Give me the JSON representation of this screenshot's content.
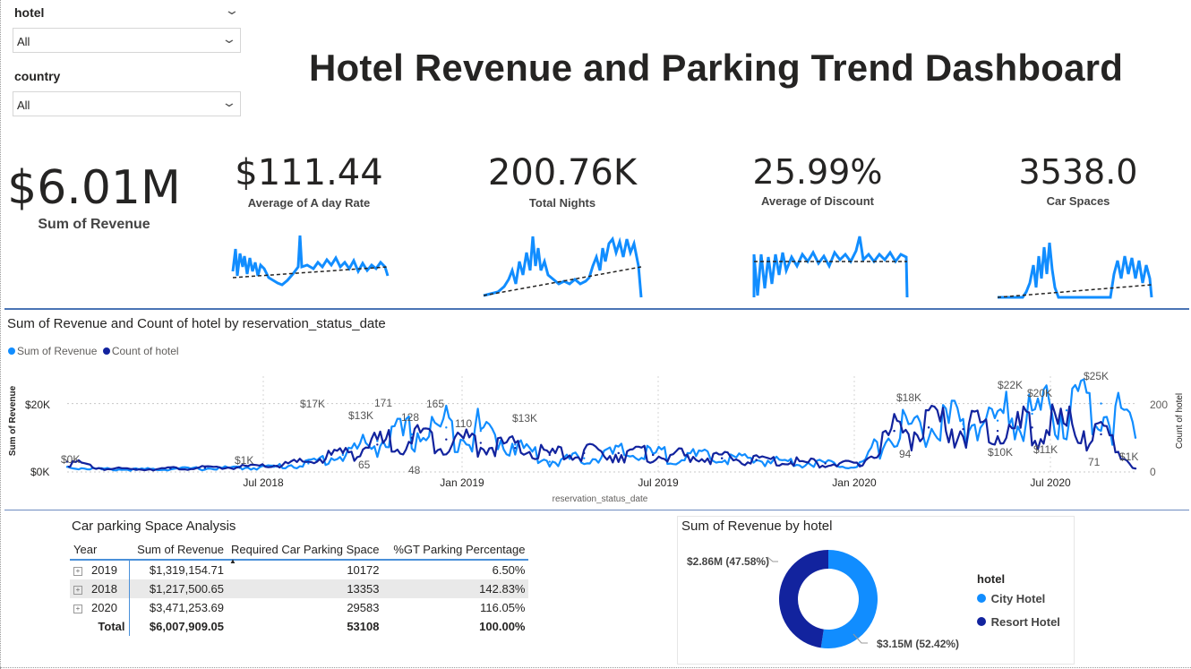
{
  "filters": {
    "hotel": {
      "label": "hotel",
      "value": "All"
    },
    "country": {
      "label": "country",
      "value": "All"
    }
  },
  "dashboard_title": "Hotel Revenue and Parking Trend Dashboard",
  "kpis": {
    "revenue": {
      "value": "$6.01M",
      "label": "Sum of Revenue"
    },
    "adr": {
      "value": "$111.44",
      "label": "Average of A day Rate"
    },
    "nights": {
      "value": "200.76K",
      "label": "Total Nights"
    },
    "discount": {
      "value": "25.99%",
      "label": "Average of Discount"
    },
    "parking": {
      "value": "3538.0",
      "label": "Car Spaces"
    }
  },
  "colors": {
    "revenue": "#118dff",
    "count": "#12239e",
    "city_hotel": "#118dff",
    "resort_hotel": "#12239e",
    "divider": "#4a74b5"
  },
  "chart_data": [
    {
      "type": "line",
      "title": "Sum of Revenue and Count of hotel by reservation_status_date",
      "xlabel": "reservation_status_date",
      "ylabel": "Sum of Revenue",
      "y2label": "Count of hotel",
      "legend_position": "top-left",
      "x_ticks": [
        "Jul 2018",
        "Jan 2019",
        "Jul 2019",
        "Jan 2020",
        "Jul 2020"
      ],
      "y_ticks": [
        "$0K",
        "$20K"
      ],
      "y2_ticks": [
        "0",
        "200"
      ],
      "ylim": [
        0,
        28000
      ],
      "y2lim": [
        0,
        280
      ],
      "grid": true,
      "x_period": [
        "2017-10",
        "2020-09"
      ],
      "series": [
        {
          "name": "Sum of Revenue",
          "axis": "left",
          "values": [
            1500,
            800,
            700,
            900,
            1000,
            1200,
            1500,
            2500,
            5000,
            9000,
            11000,
            13000,
            12000,
            8000,
            3000,
            4000,
            5500,
            5000,
            4500,
            4000,
            3500,
            3000,
            2500,
            2000,
            12000,
            13000,
            14000,
            15000,
            17000,
            18000,
            20000,
            10000
          ]
        },
        {
          "name": "Count of hotel",
          "axis": "right",
          "values": [
            30,
            10,
            8,
            10,
            12,
            14,
            18,
            30,
            55,
            80,
            100,
            95,
            85,
            70,
            50,
            55,
            55,
            50,
            45,
            40,
            35,
            30,
            25,
            20,
            120,
            130,
            125,
            120,
            130,
            135,
            110,
            10
          ]
        }
      ],
      "annotations": [
        "$0K",
        "$1K",
        "$17K",
        "$13K",
        "171",
        "128",
        "165",
        "110",
        "$13K",
        "65",
        "48",
        "$18K",
        "$22K",
        "$20K",
        "$25K",
        "94",
        "$10K",
        "$11K",
        "71",
        "$1K"
      ]
    },
    {
      "type": "table",
      "title": "Car parking Space Analysis",
      "columns": [
        "Year",
        "Sum of Revenue",
        "Required Car Parking Space",
        "%GT Parking Percentage"
      ],
      "rows": [
        {
          "year": "2019",
          "revenue": "$1,319,154.71",
          "parking": "10172",
          "pct": "6.50%"
        },
        {
          "year": "2018",
          "revenue": "$1,217,500.65",
          "parking": "13353",
          "pct": "142.83%"
        },
        {
          "year": "2020",
          "revenue": "$3,471,253.69",
          "parking": "29583",
          "pct": "116.05%"
        }
      ],
      "total": {
        "label": "Total",
        "revenue": "$6,007,909.05",
        "parking": "53108",
        "pct": "100.00%"
      }
    },
    {
      "type": "pie",
      "title": "Sum of Revenue by hotel",
      "legend_title": "hotel",
      "legend_position": "right",
      "slices": [
        {
          "name": "City Hotel",
          "value": 3.15,
          "label": "$3.15M (52.42%)"
        },
        {
          "name": "Resort Hotel",
          "value": 2.86,
          "label": "$2.86M (47.58%)"
        }
      ]
    }
  ]
}
